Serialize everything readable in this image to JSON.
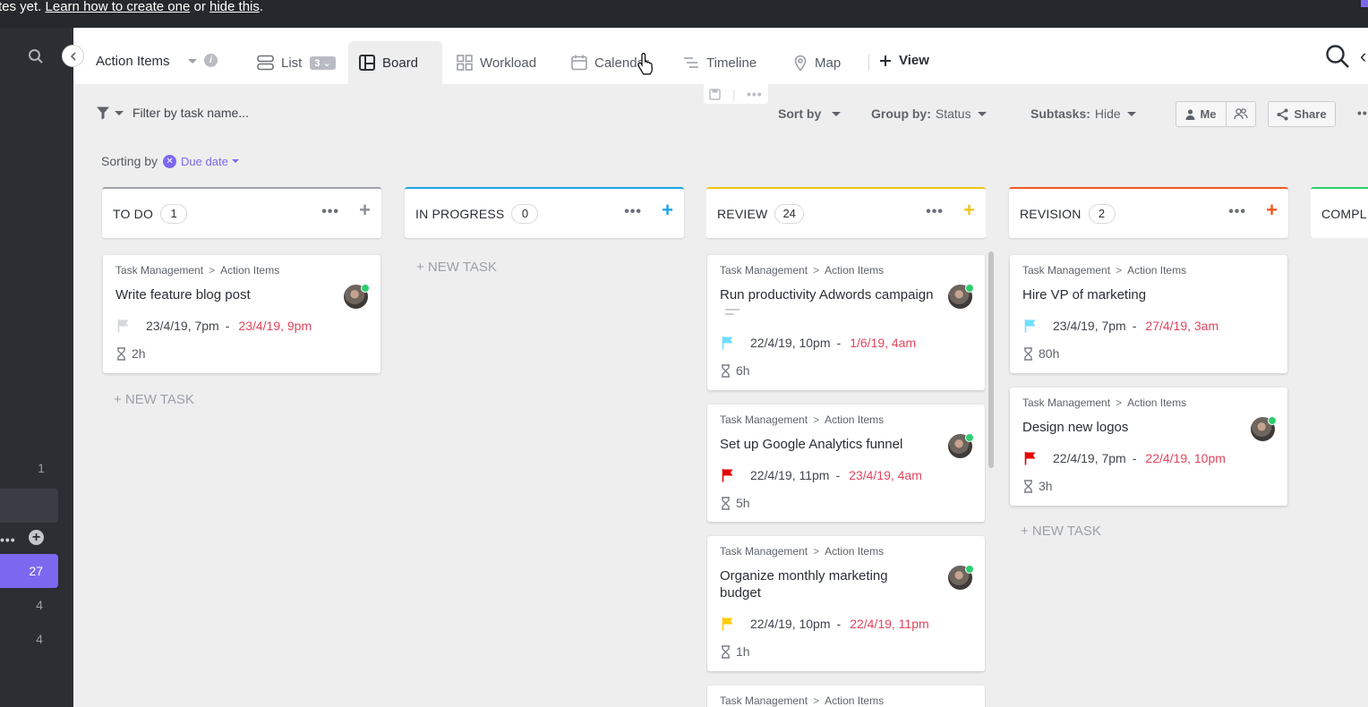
{
  "banner": {
    "text_prefix": "tes yet. ",
    "link_create": "Learn how to create one",
    "text_mid": " or ",
    "link_hide": "hide this",
    "text_end": "."
  },
  "sidebar": {
    "numbers": [
      "1",
      "27",
      "4",
      "4"
    ]
  },
  "header": {
    "title": "Action Items",
    "tabs": [
      {
        "label": "List",
        "badge": "3"
      },
      {
        "label": "Board"
      },
      {
        "label": "Workload"
      },
      {
        "label": "Calendar"
      },
      {
        "label": "Timeline"
      },
      {
        "label": "Map"
      }
    ],
    "add_view": "View"
  },
  "toolbar": {
    "filter_placeholder": "Filter by task name...",
    "sort_by": "Sort by",
    "group_by_label": "Group by:",
    "group_by_value": "Status",
    "subtasks_label": "Subtasks:",
    "subtasks_value": "Hide",
    "me": "Me",
    "share": "Share"
  },
  "sorting": {
    "label": "Sorting by",
    "value": "Due date"
  },
  "colors": {
    "accent": "#7b68ee",
    "todo": "#a0a4aa",
    "in_progress": "#1ba5e6",
    "review": "#f0c419",
    "revision": "#f05a22",
    "complete": "#2ecd6f",
    "overdue": "#e2445c"
  },
  "board": {
    "new_task": "+ NEW TASK",
    "columns": [
      {
        "name": "TO DO",
        "count": "1",
        "cards": [
          {
            "crumb_a": "Task Management",
            "crumb_b": "Action Items",
            "title": "Write feature blog post",
            "start": "23/4/19, 7pm",
            "due": "23/4/19, 9pm",
            "estimate": "2h",
            "flag": "#d6d8db"
          }
        ]
      },
      {
        "name": "IN PROGRESS",
        "count": "0",
        "cards": []
      },
      {
        "name": "REVIEW",
        "count": "24",
        "cards": [
          {
            "crumb_a": "Task Management",
            "crumb_b": "Action Items",
            "title": "Run productivity Adwords campaign",
            "start": "22/4/19, 10pm",
            "due": "1/6/19, 4am",
            "estimate": "6h",
            "flag": "#6fddff"
          },
          {
            "crumb_a": "Task Management",
            "crumb_b": "Action Items",
            "title": "Set up Google Analytics funnel",
            "start": "22/4/19, 11pm",
            "due": "23/4/19, 4am",
            "estimate": "5h",
            "flag": "#e50000"
          },
          {
            "crumb_a": "Task Management",
            "crumb_b": "Action Items",
            "title": "Organize monthly marketing budget",
            "start": "22/4/19, 10pm",
            "due": "22/4/19, 11pm",
            "estimate": "1h",
            "flag": "#ffcc00"
          },
          {
            "crumb_a": "Task Management",
            "crumb_b": "Action Items"
          }
        ]
      },
      {
        "name": "REVISION",
        "count": "2",
        "cards": [
          {
            "crumb_a": "Task Management",
            "crumb_b": "Action Items",
            "title": "Hire VP of marketing",
            "start": "23/4/19, 7pm",
            "due": "27/4/19, 3am",
            "estimate": "80h",
            "flag": "#6fddff"
          },
          {
            "crumb_a": "Task Management",
            "crumb_b": "Action Items",
            "title": "Design new logos",
            "start": "22/4/19, 7pm",
            "due": "22/4/19, 10pm",
            "estimate": "3h",
            "flag": "#e50000"
          }
        ]
      },
      {
        "name": "COMPL"
      }
    ]
  }
}
